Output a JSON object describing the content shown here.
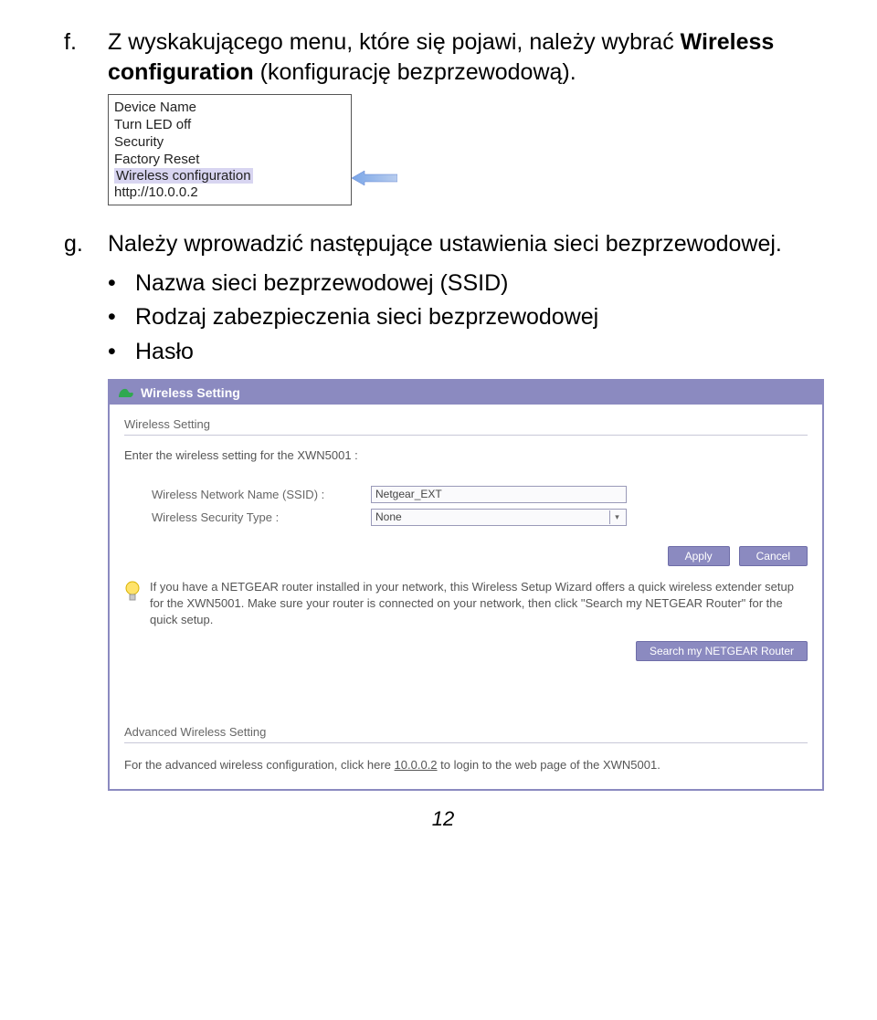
{
  "step_f": {
    "marker": "f.",
    "text_prefix": "Z wyskakującego menu, które się pojawi, należy wybrać ",
    "text_bold": "Wireless configuration",
    "text_suffix": " (konfigurację bezprzewodową)."
  },
  "menu": {
    "items": [
      "Device Name",
      "Turn LED off",
      "Security",
      "Factory Reset",
      "Wireless configuration",
      "http://10.0.0.2"
    ]
  },
  "step_g": {
    "marker": "g.",
    "text": "Należy wprowadzić następujące ustawienia sieci bezprzewodowej."
  },
  "bullets": [
    "Nazwa sieci bezprzewodowej (SSID)",
    "Rodzaj zabezpieczenia sieci bezprzewodowej",
    "Hasło"
  ],
  "panel": {
    "title": "Wireless Setting",
    "section1_title": "Wireless Setting",
    "prompt": "Enter the wireless setting for the XWN5001 :",
    "ssid_label": "Wireless Network Name (SSID) :",
    "ssid_value": "Netgear_EXT",
    "sectype_label": "Wireless Security Type :",
    "sectype_value": "None",
    "apply": "Apply",
    "cancel": "Cancel",
    "tip": "If you have a NETGEAR router installed in your network, this Wireless Setup Wizard offers a quick wireless extender setup for the XWN5001. Make sure your router is connected on your network, then click \"Search my NETGEAR Router\" for the quick setup.",
    "search_btn": "Search my NETGEAR Router",
    "adv_title": "Advanced Wireless Setting",
    "adv_pre": "For the advanced wireless configuration, click here ",
    "adv_link": "10.0.0.2",
    "adv_post": " to login to the web page of the XWN5001."
  },
  "page_number": "12"
}
